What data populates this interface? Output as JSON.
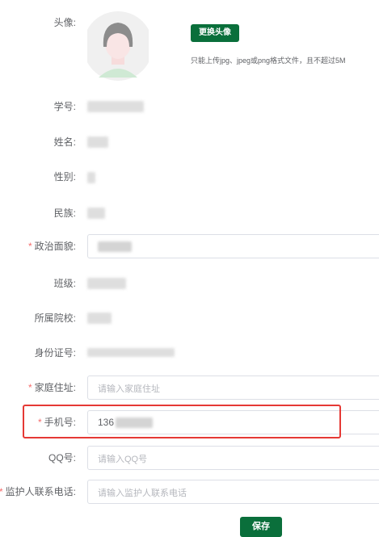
{
  "avatar": {
    "label": "头像:",
    "change_button": "更换头像",
    "hint": "只能上传jpg、jpeg或png格式文件，且不超过5M"
  },
  "fields": {
    "student_id": {
      "label": "学号:"
    },
    "name": {
      "label": "姓名:"
    },
    "gender": {
      "label": "性别:"
    },
    "ethnicity": {
      "label": "民族:"
    },
    "political_status": {
      "label": "政治面貌:",
      "required": "*"
    },
    "class_name": {
      "label": "班级:"
    },
    "school": {
      "label": "所属院校:"
    },
    "id_number": {
      "label": "身份证号:"
    },
    "home_address": {
      "label": "家庭住址:",
      "required": "*",
      "placeholder": "请输入家庭住址"
    },
    "phone": {
      "label": "手机号:",
      "required": "*",
      "value": "136"
    },
    "qq": {
      "label": "QQ号:",
      "placeholder": "请输入QQ号"
    },
    "guardian_phone": {
      "label": "监护人联系电话:",
      "required": "*",
      "placeholder": "请输入监护人联系电话"
    }
  },
  "save_button": "保存",
  "colors": {
    "primary": "#0a6f3b",
    "required": "#f56c6c",
    "highlight": "#e53935"
  }
}
